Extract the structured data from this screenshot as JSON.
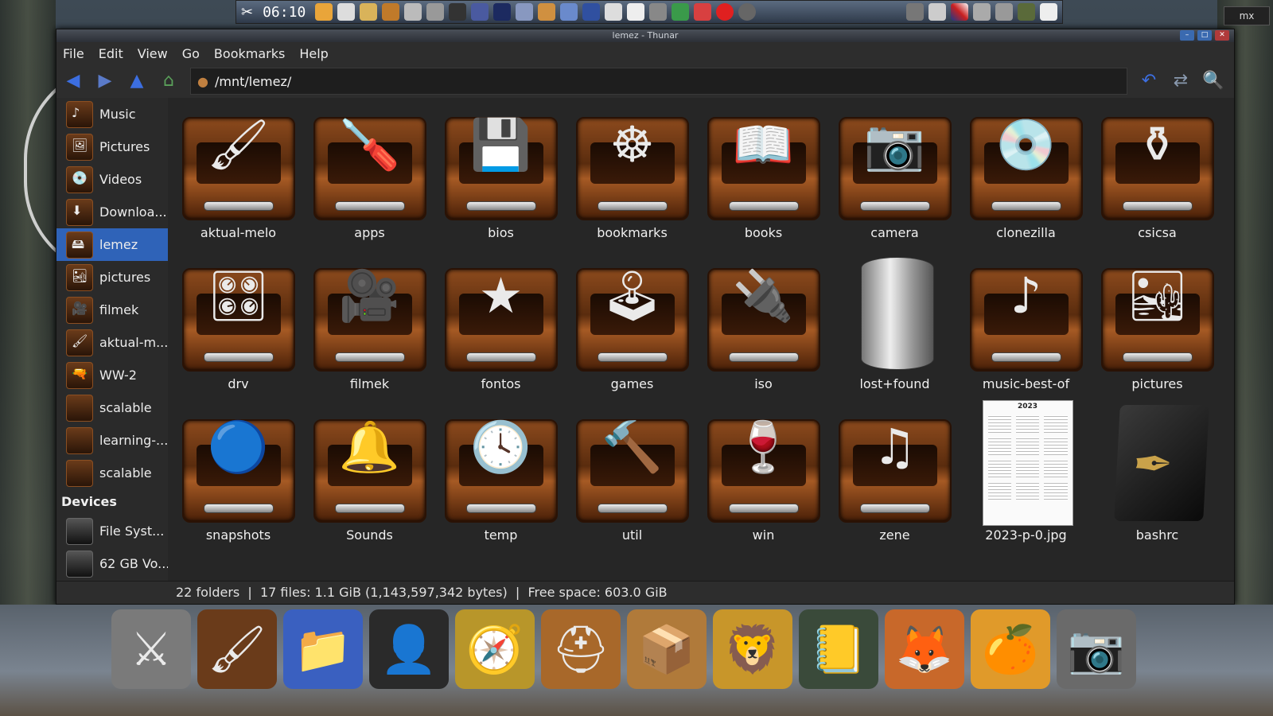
{
  "top_panel": {
    "clock": "06:10"
  },
  "window": {
    "title": "lemez - Thunar"
  },
  "menu": [
    "File",
    "Edit",
    "View",
    "Go",
    "Bookmarks",
    "Help"
  ],
  "location": {
    "path": "/mnt/lemez/"
  },
  "sidebar": {
    "places": [
      {
        "label": "Music",
        "icon": "music-note-icon"
      },
      {
        "label": "Pictures",
        "icon": "pictures-icon"
      },
      {
        "label": "Videos",
        "icon": "disc-icon"
      },
      {
        "label": "Downloa...",
        "icon": "download-icon"
      },
      {
        "label": "lemez",
        "icon": "drive-icon",
        "active": true
      },
      {
        "label": "pictures",
        "icon": "desert-icon"
      },
      {
        "label": "filmek",
        "icon": "camcorder-icon"
      },
      {
        "label": "aktual-m...",
        "icon": "paint-brush-icon"
      },
      {
        "label": "WW-2",
        "icon": "pistol-icon"
      },
      {
        "label": "scalable",
        "icon": "drawer-icon"
      },
      {
        "label": "learning-...",
        "icon": "drawer-icon"
      },
      {
        "label": "scalable",
        "icon": "drawer-icon"
      }
    ],
    "devices_heading": "Devices",
    "devices": [
      {
        "label": "File Syst...",
        "icon": "hard-disk-icon"
      },
      {
        "label": "62 GB Vo...",
        "icon": "hard-disk-icon"
      }
    ]
  },
  "files": [
    {
      "name": "aktual-melo",
      "icon": "paint-brush-icon",
      "glyph": "🖌"
    },
    {
      "name": "apps",
      "icon": "screwdrivers-icon",
      "glyph": "🪛"
    },
    {
      "name": "bios",
      "icon": "chip-icon",
      "glyph": "💾"
    },
    {
      "name": "bookmarks",
      "icon": "ship-wheel-icon",
      "glyph": "☸"
    },
    {
      "name": "books",
      "icon": "open-book-icon",
      "glyph": "📖"
    },
    {
      "name": "camera",
      "icon": "camera-icon",
      "glyph": "📷"
    },
    {
      "name": "clonezilla",
      "icon": "hard-disk-icon",
      "glyph": "💿"
    },
    {
      "name": "csicsa",
      "icon": "vase-icon",
      "glyph": "⚱"
    },
    {
      "name": "drv",
      "icon": "memory-icon",
      "glyph": "🎛"
    },
    {
      "name": "filmek",
      "icon": "camcorder-icon",
      "glyph": "🎥"
    },
    {
      "name": "fontos",
      "icon": "stars-icon",
      "glyph": "★"
    },
    {
      "name": "games",
      "icon": "joystick-icon",
      "glyph": "🕹"
    },
    {
      "name": "iso",
      "icon": "usb-drive-icon",
      "glyph": "🔌"
    },
    {
      "name": "lost+found",
      "icon": "trash-can-icon",
      "glyph": ""
    },
    {
      "name": "music-best-of",
      "icon": "music-note-icon",
      "glyph": "♪"
    },
    {
      "name": "pictures",
      "icon": "desert-icon",
      "glyph": "🏜"
    },
    {
      "name": "snapshots",
      "icon": "lens-icon",
      "glyph": "🔵"
    },
    {
      "name": "Sounds",
      "icon": "bell-icon",
      "glyph": "🔔"
    },
    {
      "name": "temp",
      "icon": "clock-icon",
      "glyph": "🕓"
    },
    {
      "name": "util",
      "icon": "hammer-icon",
      "glyph": "🔨"
    },
    {
      "name": "win",
      "icon": "wine-glass-icon",
      "glyph": "🍷"
    },
    {
      "name": "zene",
      "icon": "music-notes-icon",
      "glyph": "♫"
    },
    {
      "name": "2023-p-0.jpg",
      "icon": "calendar-image-icon",
      "glyph": "",
      "calendar_year": "2023"
    },
    {
      "name": "bashrc",
      "icon": "fountain-pen-icon",
      "glyph": "✒"
    }
  ],
  "status": {
    "folders": "22 folders",
    "files": "17 files: 1.1 GiB (1,143,597,342 bytes)",
    "free": "Free space: 603.0 GiB"
  },
  "dock": [
    {
      "icon": "knight-helmet-icon",
      "glyph": "⚔"
    },
    {
      "icon": "paint-brush-icon",
      "glyph": "🖌"
    },
    {
      "icon": "folder-icon",
      "glyph": "📁"
    },
    {
      "icon": "terminal-user-icon",
      "glyph": "👤"
    },
    {
      "icon": "sextant-icon",
      "glyph": "🧭"
    },
    {
      "icon": "diving-helmet-icon",
      "glyph": "⛑"
    },
    {
      "icon": "package-crate-icon",
      "glyph": "📦"
    },
    {
      "icon": "lion-cub-icon",
      "glyph": "🦁"
    },
    {
      "icon": "address-book-icon",
      "glyph": "📒"
    },
    {
      "icon": "fox-icon",
      "glyph": "🦊"
    },
    {
      "icon": "orange-fruit-icon",
      "glyph": "🍊"
    },
    {
      "icon": "camera-icon",
      "glyph": "📷"
    }
  ]
}
